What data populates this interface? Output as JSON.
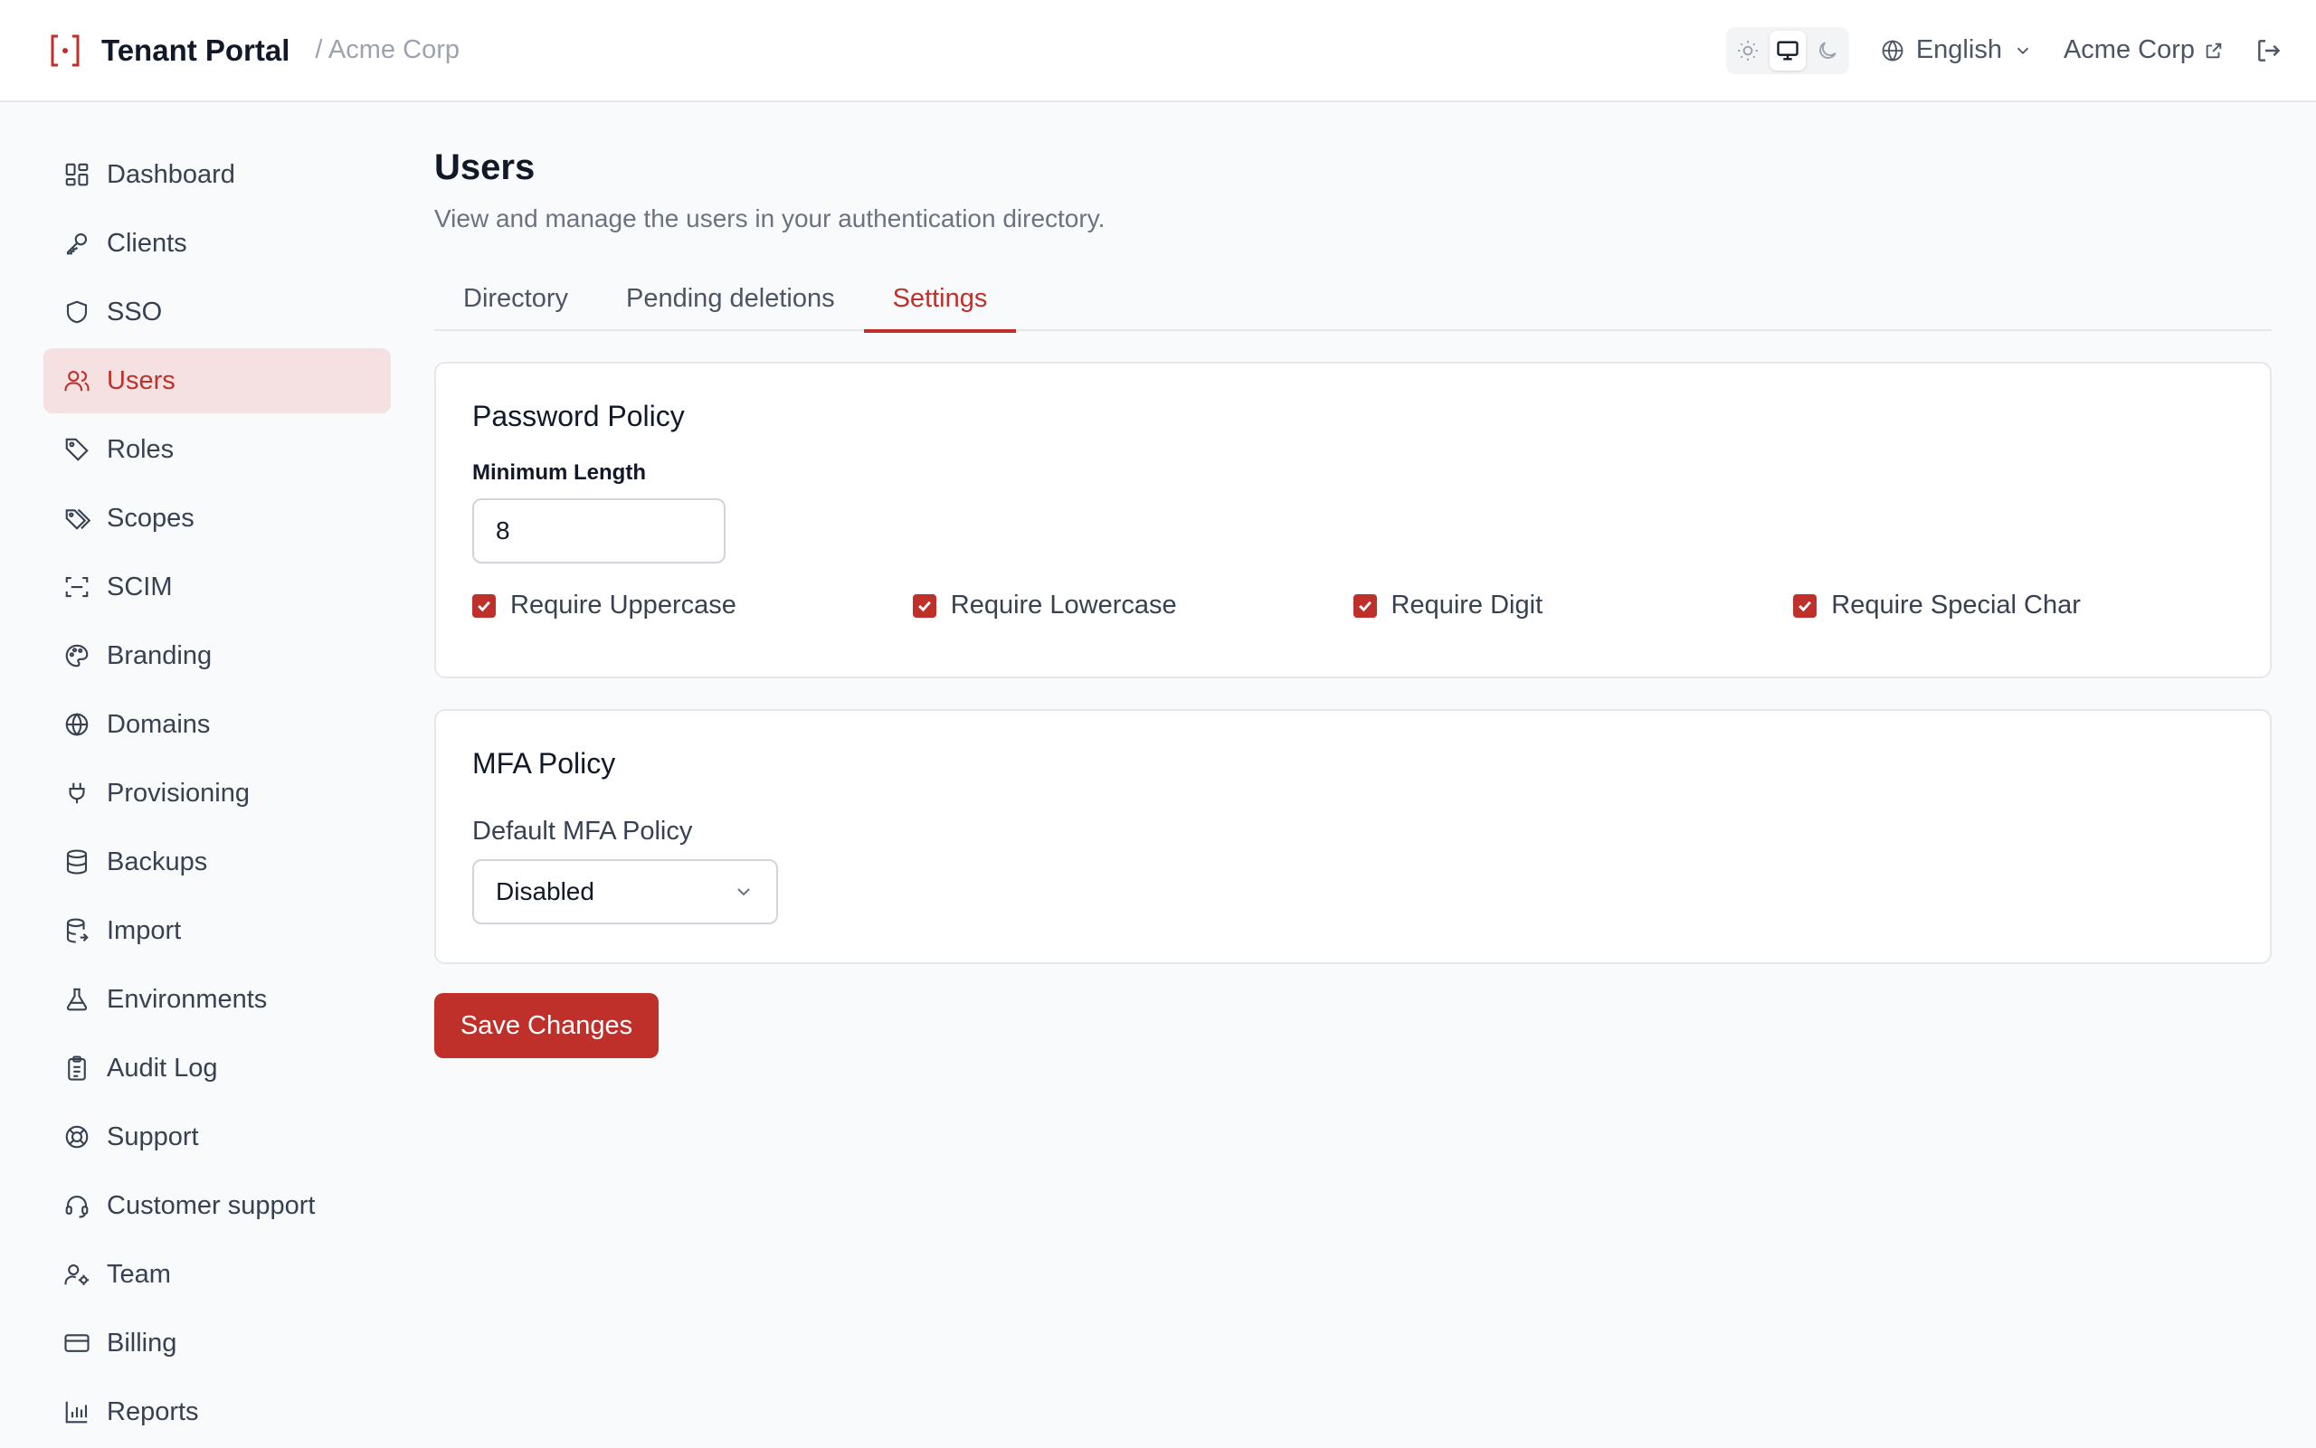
{
  "header": {
    "app_title": "Tenant Portal",
    "breadcrumb": "/ Acme Corp",
    "language": "English",
    "tenant_name": "Acme Corp",
    "theme_options": [
      "light",
      "system",
      "dark"
    ],
    "active_theme": "system"
  },
  "sidebar": {
    "items": [
      {
        "label": "Dashboard",
        "icon": "dashboard-icon"
      },
      {
        "label": "Clients",
        "icon": "key-icon"
      },
      {
        "label": "SSO",
        "icon": "shield-icon"
      },
      {
        "label": "Users",
        "icon": "users-icon",
        "active": true
      },
      {
        "label": "Roles",
        "icon": "tag-icon"
      },
      {
        "label": "Scopes",
        "icon": "tags-icon"
      },
      {
        "label": "SCIM",
        "icon": "scan-icon"
      },
      {
        "label": "Branding",
        "icon": "palette-icon"
      },
      {
        "label": "Domains",
        "icon": "globe-icon"
      },
      {
        "label": "Provisioning",
        "icon": "plug-icon"
      },
      {
        "label": "Backups",
        "icon": "database-icon"
      },
      {
        "label": "Import",
        "icon": "database-import-icon"
      },
      {
        "label": "Environments",
        "icon": "flask-icon"
      },
      {
        "label": "Audit Log",
        "icon": "clipboard-icon"
      },
      {
        "label": "Support",
        "icon": "lifebuoy-icon"
      },
      {
        "label": "Customer support",
        "icon": "headset-icon"
      },
      {
        "label": "Team",
        "icon": "user-cog-icon"
      },
      {
        "label": "Billing",
        "icon": "credit-card-icon"
      },
      {
        "label": "Reports",
        "icon": "bar-chart-icon"
      }
    ]
  },
  "main": {
    "title": "Users",
    "subtitle": "View and manage the users in your authentication directory.",
    "tabs": [
      {
        "label": "Directory"
      },
      {
        "label": "Pending deletions"
      },
      {
        "label": "Settings",
        "active": true
      }
    ],
    "password_policy": {
      "title": "Password Policy",
      "min_length_label": "Minimum Length",
      "min_length_value": "8",
      "checkboxes": [
        {
          "label": "Require Uppercase",
          "checked": true
        },
        {
          "label": "Require Lowercase",
          "checked": true
        },
        {
          "label": "Require Digit",
          "checked": true
        },
        {
          "label": "Require Special Char",
          "checked": true
        }
      ]
    },
    "mfa_policy": {
      "title": "MFA Policy",
      "default_label": "Default MFA Policy",
      "selected": "Disabled"
    },
    "save_label": "Save Changes"
  },
  "colors": {
    "accent": "#c0302a",
    "active_nav_bg": "#f5e1e1"
  }
}
